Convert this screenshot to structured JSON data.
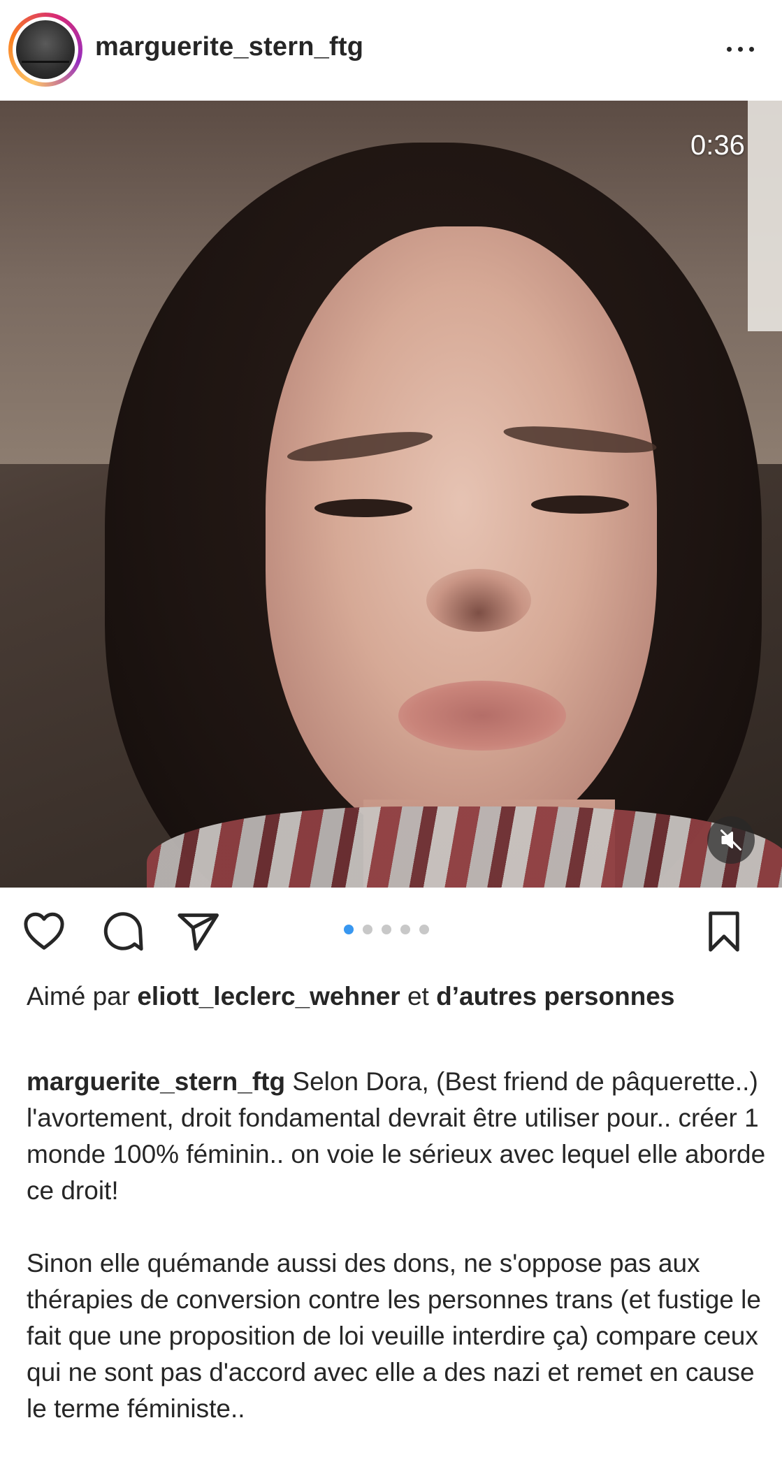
{
  "post": {
    "username": "marguerite_stern_ftg",
    "more_icon": "more-horizontal-icon",
    "video": {
      "duration": "0:36",
      "muted": true,
      "mute_icon": "speaker-muted-icon"
    },
    "carousel": {
      "total": 5,
      "active_index": 0
    },
    "actions": {
      "like_icon": "heart-icon",
      "comment_icon": "comment-icon",
      "share_icon": "send-icon",
      "save_icon": "bookmark-icon"
    },
    "likes": {
      "prefix": "Aimé par",
      "user": "eliott_leclerc_wehner",
      "connector": "et",
      "others": "d’autres personnes"
    },
    "caption": {
      "user": "marguerite_stern_ftg",
      "paragraph1": "Selon Dora, (Best friend de pâquerette..) l'avortement, droit fondamental devrait être utiliser pour.. créer 1 monde 100% féminin.. on voie le sérieux avec lequel elle aborde  ce droit!",
      "paragraph2": "Sinon elle quémande aussi des dons, ne s'oppose pas aux thérapies de conversion contre les personnes trans (et fustige le fait que une proposition de loi veuille interdire ça) compare ceux qui ne sont pas d'accord avec elle a des nazi et remet en cause le terme féministe.."
    },
    "colors": {
      "text": "#262626",
      "dot_active": "#3897f0",
      "dot_inactive": "#c8c8c8"
    }
  }
}
